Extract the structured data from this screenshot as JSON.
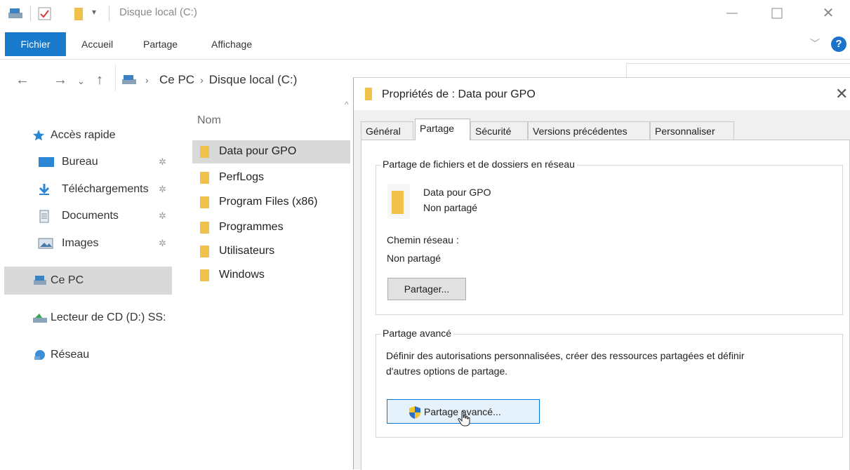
{
  "window": {
    "title": "Disque local (C:)"
  },
  "ribbon": {
    "tabs": [
      "Fichier",
      "Accueil",
      "Partage",
      "Affichage"
    ]
  },
  "address": {
    "breadcrumb": [
      "Ce PC",
      "Disque local (C:)"
    ]
  },
  "sidebar": {
    "items": [
      {
        "label": "Accès rapide",
        "icon": "star-icon"
      },
      {
        "label": "Bureau",
        "icon": "desktop-icon",
        "pinned": true
      },
      {
        "label": "Téléchargements",
        "icon": "download-icon",
        "pinned": true
      },
      {
        "label": "Documents",
        "icon": "document-icon",
        "pinned": true
      },
      {
        "label": "Images",
        "icon": "images-icon",
        "pinned": true
      },
      {
        "label": "Ce PC",
        "icon": "computer-icon",
        "selected": true
      },
      {
        "label": "Lecteur de CD (D:) SS:",
        "icon": "cd-drive-icon"
      },
      {
        "label": "Réseau",
        "icon": "network-icon"
      }
    ]
  },
  "filelist": {
    "column_header": "Nom",
    "files": [
      "Data pour GPO",
      "PerfLogs",
      "Program Files (x86)",
      "Programmes",
      "Utilisateurs",
      "Windows"
    ],
    "selected_index": 0
  },
  "dialog": {
    "title": "Propriétés de : Data pour GPO",
    "tabs": [
      "Général",
      "Partage",
      "Sécurité",
      "Versions précédentes",
      "Personnaliser"
    ],
    "active_tab": "Partage",
    "network_sharing": {
      "group_title": "Partage de fichiers et de dossiers en réseau",
      "folder_name": "Data pour GPO",
      "status": "Non partagé",
      "network_path_label": "Chemin réseau :",
      "network_path_value": "Non partagé",
      "share_button": "Partager..."
    },
    "advanced_sharing": {
      "group_title": "Partage avancé",
      "description_line1": "Définir des autorisations personnalisées, créer des ressources partagées et définir",
      "description_line2": "d'autres options de partage.",
      "button": "Partage avancé..."
    }
  },
  "colors": {
    "accent": "#1979ca",
    "folder": "#f0c24b",
    "selection": "#d9d9d9",
    "dialog_bg": "#f0f0f0"
  }
}
